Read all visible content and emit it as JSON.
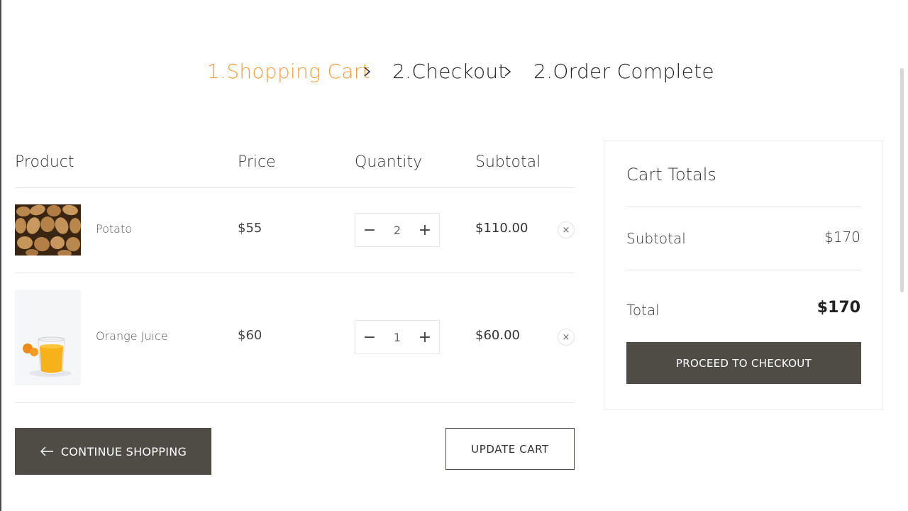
{
  "steps": [
    {
      "label": "1.Shopping Cart",
      "active": true
    },
    {
      "label": "2.Checkout",
      "active": false
    },
    {
      "label": "2.Order Complete",
      "active": false
    }
  ],
  "table": {
    "headers": {
      "product": "Product",
      "price": "Price",
      "quantity": "Quantity",
      "subtotal": "Subtotal"
    },
    "items": [
      {
        "name": "Potato",
        "price": "$55",
        "quantity": "2",
        "subtotal": "$110.00",
        "image": "potato-image"
      },
      {
        "name": "Orange Juice",
        "price": "$60",
        "quantity": "1",
        "subtotal": "$60.00",
        "image": "orange-juice-image"
      }
    ],
    "qty_minus": "−",
    "qty_plus": "+",
    "remove_symbol": "×"
  },
  "actions": {
    "continue_label": "CONTINUE SHOPPING",
    "update_label": "UPDATE CART"
  },
  "totals": {
    "title": "Cart Totals",
    "subtotal_label": "Subtotal",
    "subtotal_value": "$170",
    "total_label": "Total",
    "total_value": "$170",
    "checkout_label": "PROCEED TO CHECKOUT"
  },
  "colors": {
    "accent": "#f39c3d",
    "dark_button": "#4f4b45"
  }
}
